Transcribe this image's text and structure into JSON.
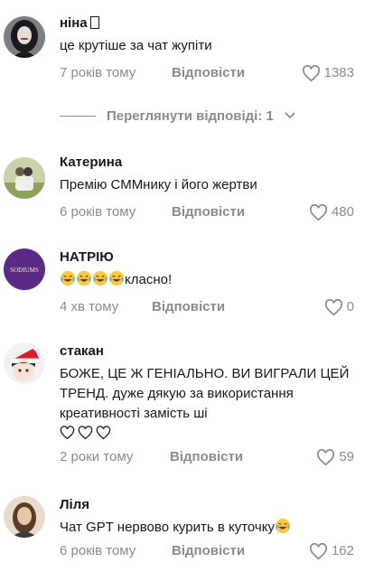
{
  "comments": [
    {
      "author": "ніна",
      "text": "це крутіше за чат жупіти",
      "time": "7 років тому",
      "reply_label": "Відповісти",
      "likes": "1383",
      "avatar_icon": "girl-portrait"
    },
    {
      "author": "Катерина",
      "text": "Премію СММнику і його жертви",
      "time": "6 років тому",
      "reply_label": "Відповісти",
      "likes": "480",
      "avatar_icon": "couple-photo"
    },
    {
      "author": "НАТРІЮ",
      "text": "класно!",
      "time": "4 хв тому",
      "reply_label": "Відповісти",
      "likes": "0",
      "avatar_icon": "purple-logo",
      "avatar_text": "SODIUMS"
    },
    {
      "author": "стакан",
      "text": "БОЖЕ, ЦЕ Ж ГЕНІАЛЬНО. ВИ ВИГРАЛИ ЦЕЙ ТРЕНД. дуже дякую за використання креативності замість ші",
      "time": "2 роки тому",
      "reply_label": "Відповісти",
      "likes": "59",
      "avatar_icon": "santa-hat-character"
    },
    {
      "author": "Ліля",
      "text": "Чат GPT нервово курить в куточку",
      "time": "6 років тому",
      "reply_label": "Відповісти",
      "likes": "162",
      "avatar_icon": "girl-portrait-2"
    }
  ],
  "view_replies": {
    "label": "Переглянути відповіді: 1"
  },
  "colors": {
    "text": "#161823",
    "muted": "#8a8b91",
    "accent_purple": "#5a2b86"
  }
}
